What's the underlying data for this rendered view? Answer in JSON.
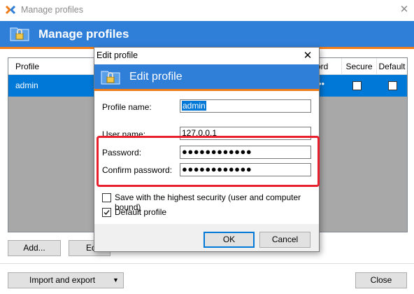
{
  "manage_window": {
    "title": "Manage profiles",
    "banner_title": "Manage profiles",
    "columns": [
      "Profile",
      "ord",
      "Secure",
      "Default"
    ],
    "rows": [
      {
        "profile": "admin",
        "password_dots": "••",
        "secure": false,
        "default": false
      }
    ],
    "buttons": {
      "add": "Add...",
      "edit": "Ed",
      "import_export": "Import and export",
      "close": "Close"
    }
  },
  "edit_dialog": {
    "title": "Edit profile",
    "banner_title": "Edit profile",
    "fields": {
      "profile_name_label": "Profile name:",
      "profile_name_value": "admin",
      "user_name_label": "User name:",
      "user_name_value": "127.0.0.1",
      "password_label": "Password:",
      "password_value": "●●●●●●●●●●●●",
      "confirm_password_label": "Confirm password:",
      "confirm_password_value": "●●●●●●●●●●●●"
    },
    "options": {
      "high_security_label": "Save with the highest security (user and computer bound)",
      "high_security_checked": false,
      "default_profile_label": "Default profile",
      "default_profile_checked": true
    },
    "buttons": {
      "ok": "OK",
      "cancel": "Cancel"
    }
  },
  "colors": {
    "banner_blue": "#2f7ed8",
    "banner_accent_orange": "#f07c1a",
    "selection_blue": "#0078d7",
    "highlight_red": "#e8202d"
  }
}
